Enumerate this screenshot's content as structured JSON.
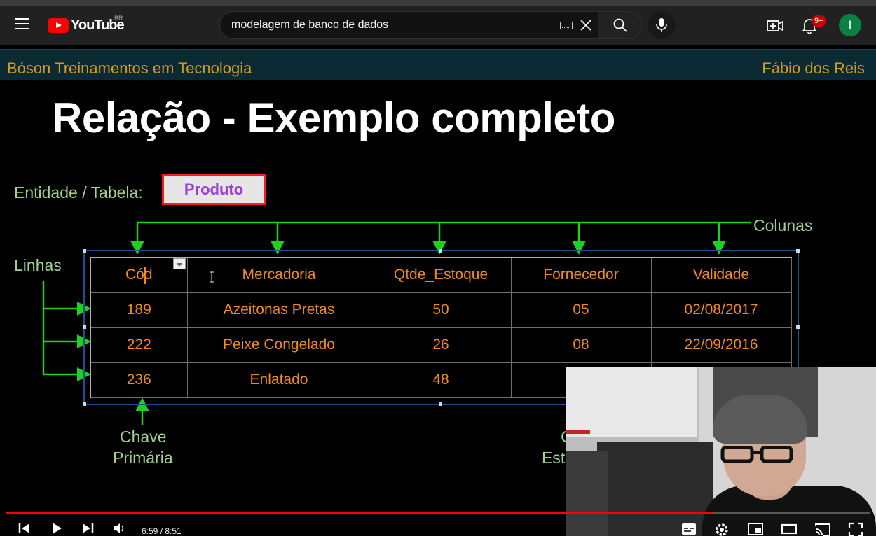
{
  "masthead": {
    "logo_text": "YouTube",
    "country_code": "BR",
    "search_query": "modelagem de banco de dados",
    "notifications_badge": "9+",
    "avatar_initial": "I"
  },
  "slide": {
    "header_left": "Bóson Treinamentos em Tecnologia",
    "header_right": "Fábio dos Reis",
    "title": "Relação - Exemplo completo",
    "entity_label": "Entidade / Tabela:",
    "entity_name": "Produto",
    "columns_label": "Colunas",
    "rows_label": "Linhas",
    "pk_label_line1": "Chave",
    "pk_label_line2": "Primária",
    "fk_label_line1": "C",
    "fk_label_line2": "Est",
    "table": {
      "headers": [
        "Cód",
        "Mercadoria",
        "Qtde_Estoque",
        "Fornecedor",
        "Validade"
      ],
      "rows": [
        [
          "189",
          "Azeitonas Pretas",
          "50",
          "05",
          "02/08/2017"
        ],
        [
          "222",
          "Peixe Congelado",
          "26",
          "08",
          "22/09/2016"
        ],
        [
          "236",
          "Enlatado",
          "48",
          "",
          ""
        ]
      ]
    }
  },
  "player": {
    "time_display": "6:59 / 8:51",
    "progress_fraction": 0.8187
  },
  "colors": {
    "accent_red": "#ff0000",
    "slide_green": "#9fd08c",
    "cell_orange": "#f08a1c",
    "header_gold": "#d29a1e"
  }
}
